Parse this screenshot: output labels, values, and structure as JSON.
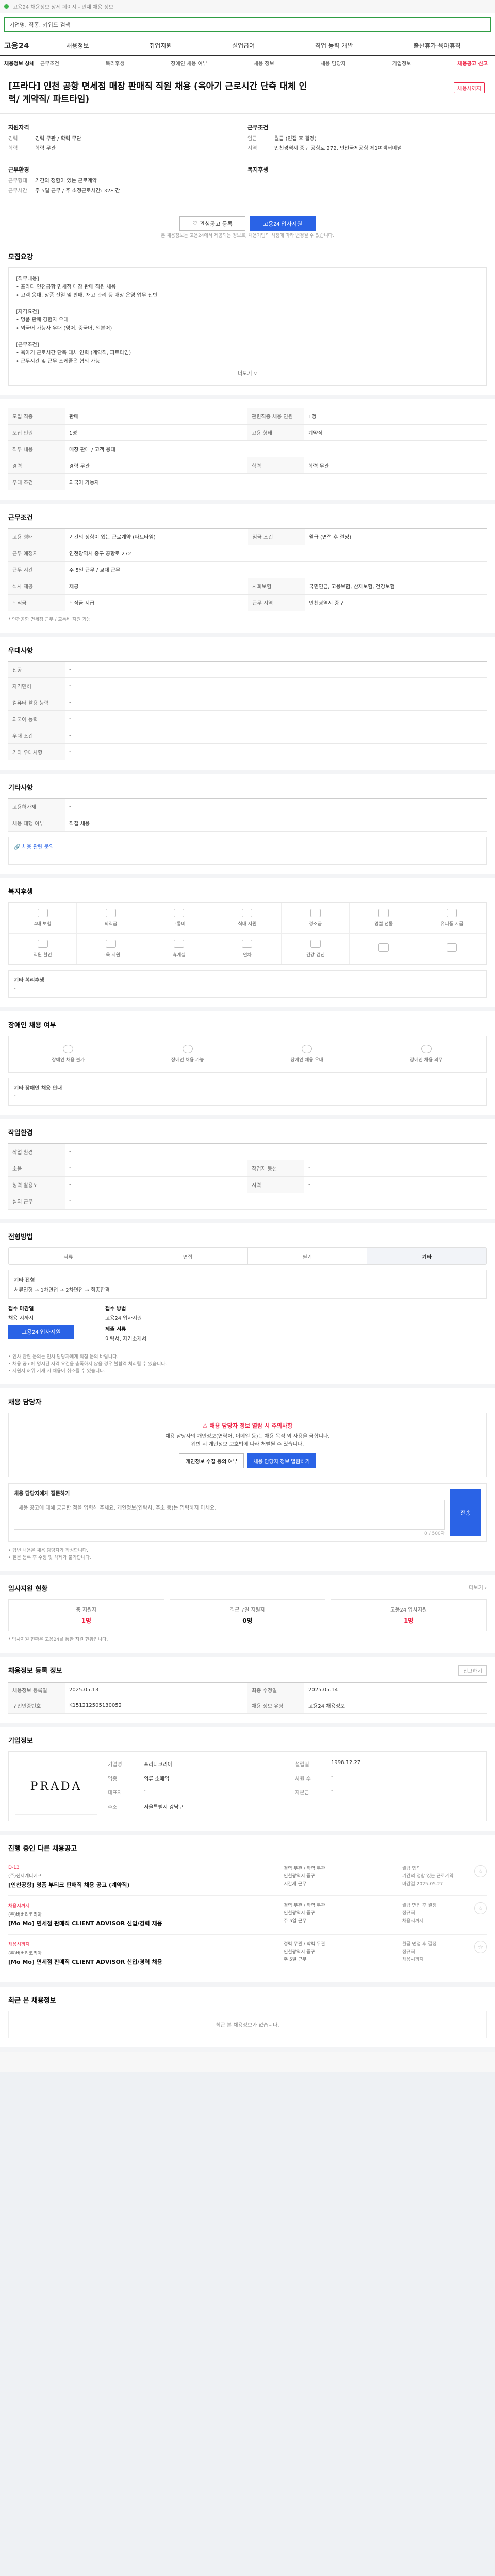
{
  "topline": {
    "text": "고용24 채용정보 상세 페이지 - 인재 채용 정보"
  },
  "search": {
    "value": "기업명, 직종, 키워드 검색"
  },
  "gnb": {
    "logo": "고용24",
    "menu": [
      "채용정보",
      "취업지원",
      "실업급여",
      "직업 능력 개발",
      "출산휴가·육아휴직"
    ]
  },
  "subnav": {
    "first": "채용정보 상세",
    "items": [
      "근무조건",
      "복리후생",
      "장애인 채용 여부",
      "채용 정보",
      "채용 담당자",
      "기업정보",
      "채용공고 신고"
    ]
  },
  "title": {
    "text": "[프라다] 인천 공항 면세점 매장 판매직 직원 채용 (육아기 근로시간 단축 대체 인력/ 계약직/ 파트타임)",
    "badge": "채용시까지"
  },
  "summary": {
    "left_title": "지원자격",
    "left": [
      {
        "k": "경력",
        "v": "경력 무관 / 학력 무관"
      },
      {
        "k": "학력",
        "v": "학력 무관"
      }
    ],
    "left_title2": "근무환경",
    "left2": [
      {
        "k": "근무형태",
        "v": "기간의 정함이 있는 근로계약"
      },
      {
        "k": "근무시간",
        "v": "주 5일 근무 / 주 소정근로시간: 32시간"
      }
    ],
    "right_title": "근무조건",
    "right": [
      {
        "k": "임금",
        "v": "월급 (면접 후 결정)"
      },
      {
        "k": "지역",
        "v": "인천광역시 중구 공항로 272, 인천국제공항 제1여객터미널"
      }
    ],
    "right_title2": "복지후생",
    "right2": []
  },
  "actions": {
    "scrap": "관심공고 등록",
    "apply": "고용24 입사지원",
    "note": "본 채용정보는 고용24에서 제공되는 정보로, 채용기업의 사정에 따라 변경될 수 있습니다."
  },
  "desc": {
    "title": "모집요강",
    "lines": [
      "[직무내용]",
      "• 프라다 인천공항 면세점 매장 판매 직원 채용",
      "• 고객 응대, 상품 진열 및 판매, 재고 관리 등 매장 운영 업무 전반",
      "",
      "[자격요건]",
      "• 명품 판매 경험자 우대",
      "• 외국어 가능자 우대 (영어, 중국어, 일본어)",
      "",
      "[근무조건]",
      "• 육아기 근로시간 단축 대체 인력 (계약직, 파트타임)",
      "• 근무시간 및 근무 스케줄은 협의 가능"
    ],
    "more": "더보기 ∨"
  },
  "recruit": {
    "title": "모집요강",
    "rows": [
      [
        "모집 직종",
        "판매",
        "관련직종 채용 인원",
        "1명"
      ],
      [
        "모집 인원",
        "1명",
        "고용 형태",
        "계약직"
      ],
      [
        "직무 내용",
        "매장 판매 / 고객 응대",
        "",
        ""
      ],
      [
        "경력",
        "경력 무관",
        "학력",
        "학력 무관"
      ],
      [
        "우대 조건",
        "외국어 가능자",
        "",
        ""
      ]
    ]
  },
  "work": {
    "title": "근무조건",
    "rows": [
      [
        "고용 형태",
        "기간의 정함이 있는 근로계약 (파트타임)",
        "임금 조건",
        "월급 (면접 후 결정)"
      ],
      [
        "근무 예정지",
        "인천광역시 중구 공항로 272",
        "",
        ""
      ],
      [
        "근무 시간",
        "주 5일 근무 / 교대 근무",
        "",
        ""
      ],
      [
        "식사 제공",
        "제공",
        "사회보험",
        "국민연금, 고용보험, 산재보험, 건강보험"
      ],
      [
        "퇴직금",
        "퇴직금 지급",
        "근무 지역",
        "인천광역시 중구"
      ]
    ],
    "note": "* 인천공항 면세점 근무 / 교통비 지원 가능"
  },
  "req": {
    "title": "우대사항",
    "rows": [
      [
        "전공",
        "-"
      ],
      [
        "자격면허",
        "-"
      ],
      [
        "컴퓨터 활용 능력",
        "-"
      ],
      [
        "외국어 능력",
        "-"
      ],
      [
        "우대 조건",
        "-"
      ],
      [
        "기타 우대사항",
        "-"
      ]
    ]
  },
  "etc": {
    "title": "기타사항",
    "rows": [
      [
        "고용허가제",
        "-"
      ],
      [
        "채용 대행 여부",
        "직접 채용"
      ]
    ],
    "link": "채용 관련 문의"
  },
  "welfare": {
    "title": "복지후생",
    "items": [
      "4대 보험",
      "퇴직금",
      "교통비",
      "식대 지원",
      "경조금",
      "명절 선물",
      "유니폼 지급",
      "직원 할인",
      "교육 지원",
      "휴게실",
      "연차",
      "건강 검진",
      "",
      ""
    ],
    "extra_title": "기타 복리후생",
    "extra": "-"
  },
  "barrier": {
    "title": "장애인 채용 여부",
    "items": [
      "장애인 채용 불가",
      "장애인 채용 가능",
      "장애인 채용 우대",
      "장애인 채용 의무"
    ],
    "extra_title": "기타 장애인 채용 안내",
    "extra": "-"
  },
  "env": {
    "title": "작업환경",
    "rows": [
      [
        "작업 환경",
        "-",
        "",
        ""
      ],
      [
        "소음",
        "-",
        "작업자 동선",
        "-"
      ],
      [
        "청력 활용도",
        "-",
        "시력",
        "-"
      ],
      [
        "실외 근무",
        "-",
        "",
        ""
      ]
    ]
  },
  "hist": {
    "title": "전형방법",
    "tabs": [
      "서류",
      "면접",
      "필기",
      "기타"
    ],
    "active": 3,
    "steps_title": "기타 전형",
    "steps": "서류전형 → 1차면접 → 2차면접 → 최종합격"
  },
  "apply": {
    "method_title": "접수 마감일",
    "method": "채용 시까지",
    "btn": "고용24 입사지원",
    "type_title": "접수 방법",
    "type": "고용24 입사지원",
    "doc_title": "제출 서류",
    "doc": "이력서, 자기소개서",
    "notes": [
      "• 인사 관련 문의는 인사 담당자에게 직접 문의 바랍니다.",
      "• 채용 공고에 명시된 자격 요건을 충족하지 않을 경우 불합격 처리될 수 있습니다.",
      "• 지원서 허위 기재 시 채용이 취소될 수 있습니다."
    ]
  },
  "contact": {
    "title": "채용 담당자",
    "warn": "채용 담당자 정보 열람 시 주의사항",
    "text1": "채용 담당자의 개인정보(연락처, 이메일 등)는 채용 목적 외 사용을 금합니다.",
    "text2": "위반 시 개인정보 보호법에 따라 처벌될 수 있습니다.",
    "b1": "개인정보 수집 동의 여부",
    "b2": "채용 담당자 정보 열람하기",
    "qa_title": "채용 담당자에게 질문하기",
    "qa_placeholder": "채용 공고에 대해 궁금한 점을 입력해 주세요. 개인정보(연락처, 주소 등)는 입력하지 마세요.",
    "qa_count": "0 / 500자",
    "qa_send": "전송",
    "notes": [
      "• 답변 내용은 채용 담당자가 작성합니다.",
      "• 질문 등록 후 수정 및 삭제가 불가합니다."
    ]
  },
  "stats": {
    "title": "입사지원 현황",
    "more": "더보기 ›",
    "items": [
      {
        "label": "총 지원자",
        "value": "1명"
      },
      {
        "label": "최근 7일 지원자",
        "value": "0명"
      },
      {
        "label": "고용24 입사지원",
        "value": "1명"
      }
    ],
    "note": "* 입사지원 현황은 고용24를 통한 지원 현황입니다."
  },
  "reg": {
    "title": "채용정보 등록 정보",
    "more": "신고하기",
    "rows": [
      [
        "채용정보 등록일",
        "2025.05.13",
        "최종 수정일",
        "2025.05.14"
      ],
      [
        "구인인증번호",
        "K151212505130052",
        "채용 정보 유형",
        "고용24 채용정보"
      ]
    ]
  },
  "company": {
    "title": "기업정보",
    "logo": "PRADA",
    "info": [
      [
        "기업명",
        "프라다코리아",
        "설립일",
        "1998.12.27"
      ],
      [
        "업종",
        "의류 소매업",
        "사원 수",
        "-"
      ],
      [
        "대표자",
        "-",
        "자본금",
        "-"
      ],
      [
        "주소",
        "서울특별시 강남구",
        "",
        ""
      ]
    ]
  },
  "similar": {
    "title": "진행 중인 다른 채용공고",
    "jobs": [
      {
        "tag": "D-13",
        "co": "(주)신세계디에프",
        "title": "[인천공항] 명품 부티크 판매직 채용 공고 (계약직)",
        "meta": "경력 무관 / 학력 무관\n인천광역시 중구\n시간제 근무",
        "right": "월급 협의\n기간의 정함 있는 근로계약\n마감일 2025.05.27"
      },
      {
        "tag": "채용시까지",
        "co": "(주)버버리코리아",
        "title": "[Mo Mo] 면세점 판매직 CLIENT ADVISOR 신입/경력 채용",
        "meta": "경력 무관 / 학력 무관\n인천광역시 중구\n주 5일 근무",
        "right": "월급 면접 후 결정\n정규직\n채용시까지"
      },
      {
        "tag": "채용시까지",
        "co": "(주)버버리코리아",
        "title": "[Mo Mo] 면세점 판매직 CLIENT ADVISOR 신입/경력 채용",
        "meta": "경력 무관 / 학력 무관\n인천광역시 중구\n주 5일 근무",
        "right": "월급 면접 후 결정\n정규직\n채용시까지"
      }
    ]
  },
  "recent": {
    "title": "최근 본 채용정보",
    "empty": "최근 본 채용정보가 없습니다."
  }
}
